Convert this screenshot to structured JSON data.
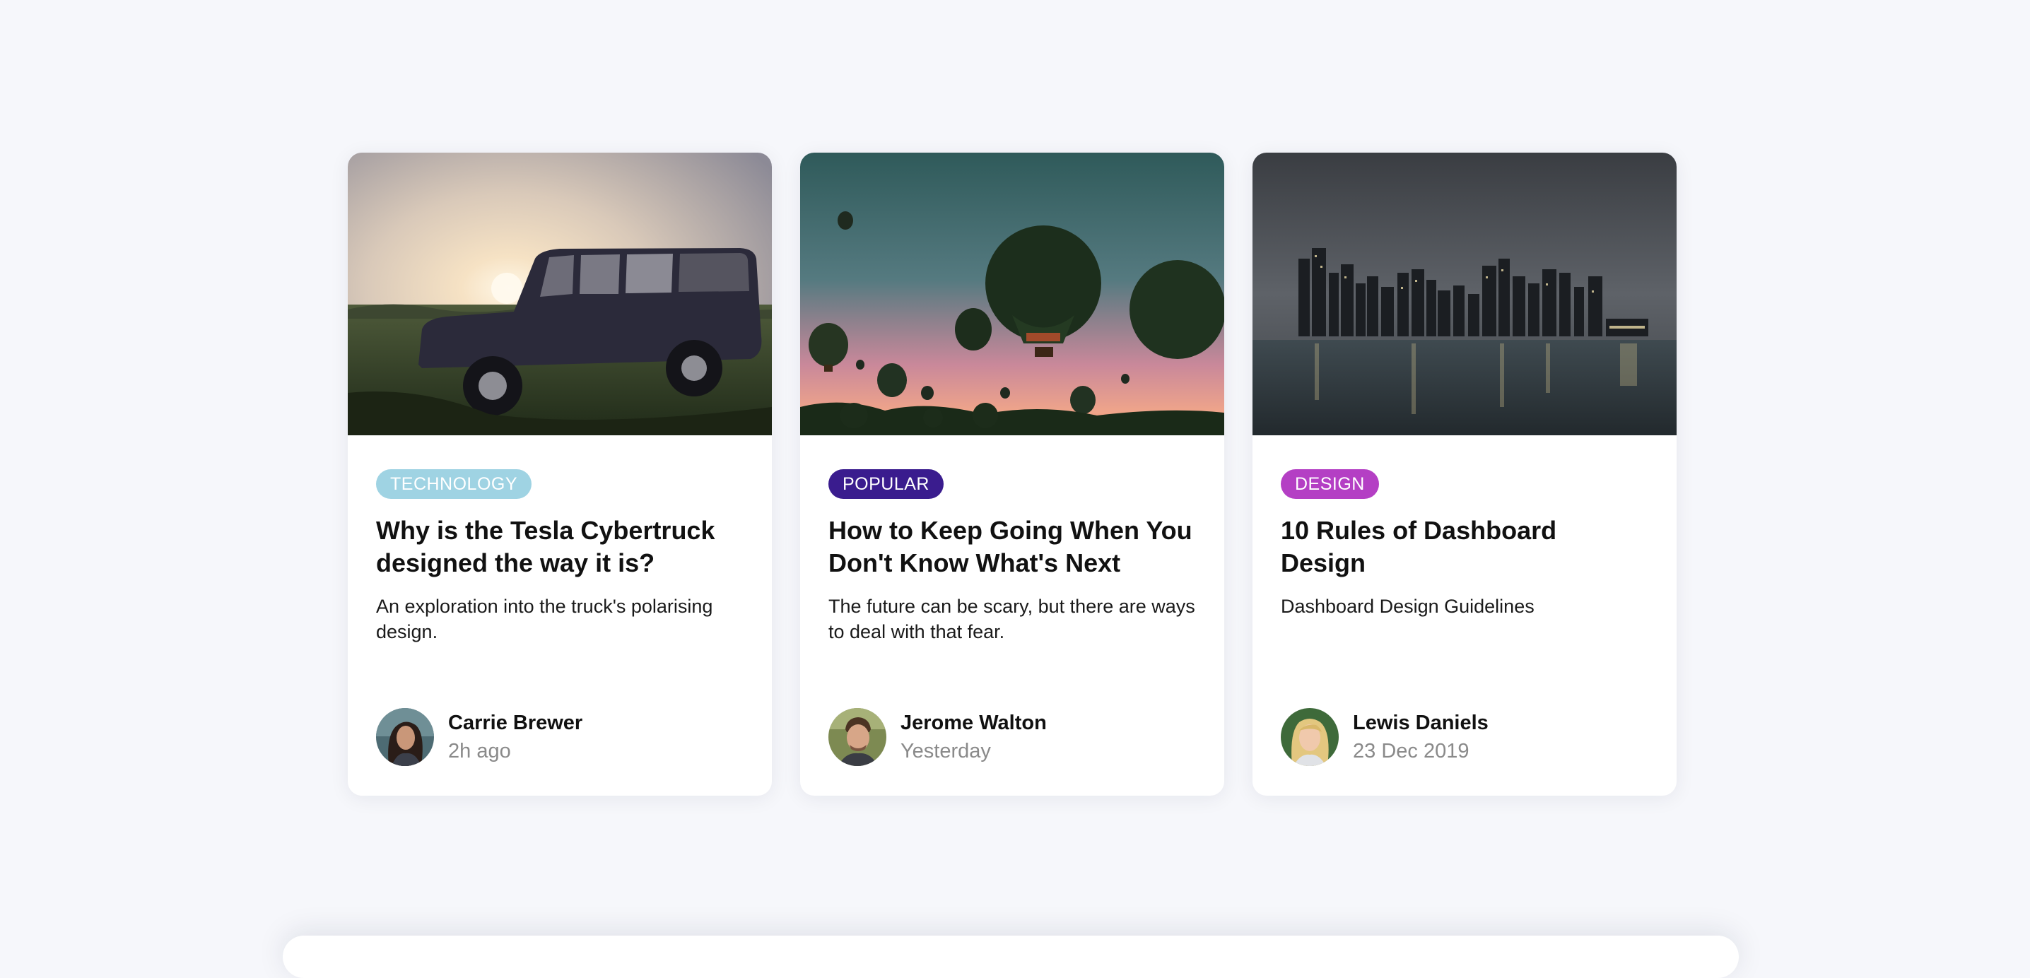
{
  "colors": {
    "background": "#f6f7fb",
    "card": "#ffffff",
    "tag_technology": "#9fd3e3",
    "tag_popular": "#3a1c8e",
    "tag_design": "#b43fc4",
    "title_text": "#111111",
    "time_text": "#8a8a8a"
  },
  "cards": [
    {
      "image": "jeep-sunset-photo",
      "tag": "TECHNOLOGY",
      "tag_color": "#9fd3e3",
      "title": "Why is the Tesla Cybertruck designed the way it is?",
      "description": "An exploration into the truck's polarising design.",
      "author": {
        "name": "Carrie Brewer",
        "time": "2h ago",
        "avatar": "woman-avatar"
      }
    },
    {
      "image": "hot-air-balloons-photo",
      "tag": "POPULAR",
      "tag_color": "#3a1c8e",
      "title": "How to Keep Going When You Don't Know What's Next",
      "description": "The future can be scary, but there are ways to deal with that fear.",
      "author": {
        "name": "Jerome Walton",
        "time": "Yesterday",
        "avatar": "man-avatar"
      }
    },
    {
      "image": "city-skyline-photo",
      "tag": "DESIGN",
      "tag_color": "#b43fc4",
      "title": "10 Rules of Dashboard Design",
      "description": "Dashboard Design Guidelines",
      "author": {
        "name": "Lewis Daniels",
        "time": "23 Dec 2019",
        "avatar": "blonde-avatar"
      }
    }
  ]
}
